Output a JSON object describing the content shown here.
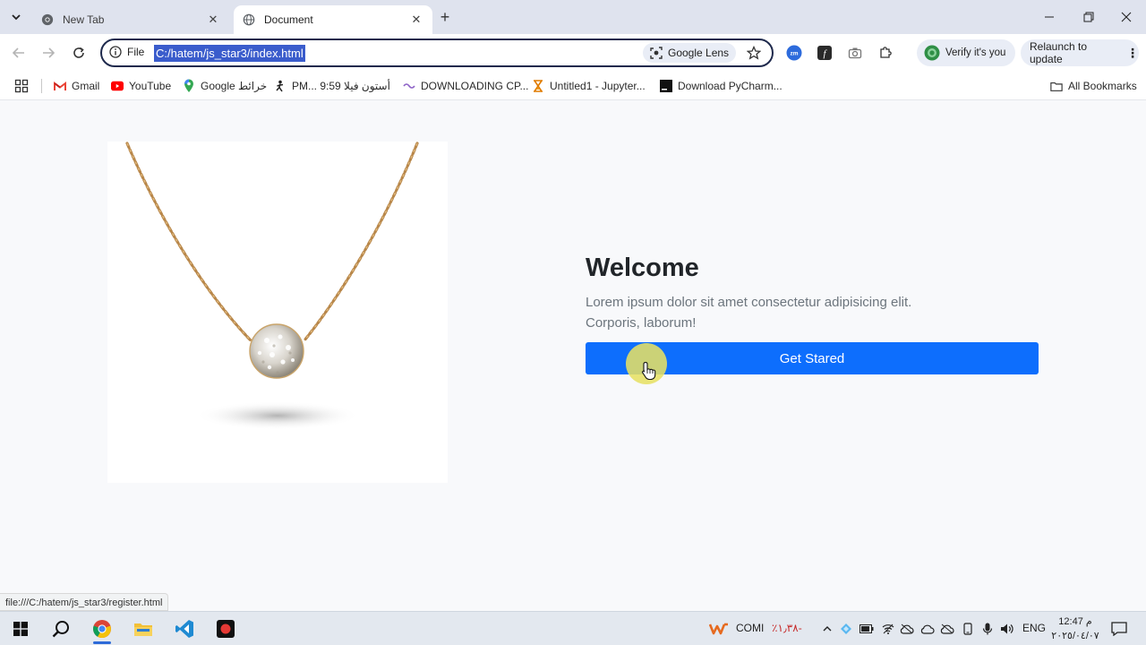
{
  "browser": {
    "tabs": [
      {
        "title": "New Tab",
        "active": false
      },
      {
        "title": "Document",
        "active": true
      }
    ],
    "address_bar": {
      "scheme_label": "File",
      "url": "C:/hatem/js_star3/index.html",
      "lens_label": "Google Lens"
    },
    "toolbar": {
      "verify_label": "Verify it's you",
      "relaunch_label": "Relaunch to update",
      "zoom_ext_label": "zm"
    },
    "bookmarks": [
      {
        "label": "Gmail",
        "icon": "gmail-icon"
      },
      {
        "label": "YouTube",
        "icon": "youtube-icon"
      },
      {
        "label": "Google خرائط",
        "icon": "maps-icon"
      },
      {
        "label": "PM... 9:59 أستون فيلا",
        "icon": "sports-icon"
      },
      {
        "label": "DOWNLOADING CP...",
        "icon": "site-icon"
      },
      {
        "label": "Untitled1 - Jupyter...",
        "icon": "jupyter-icon"
      },
      {
        "label": "Download PyCharm...",
        "icon": "pycharm-icon"
      }
    ],
    "all_bookmarks_label": "All Bookmarks",
    "status_url": "file:///C:/hatem/js_star3/register.html"
  },
  "page": {
    "title": "Welcome",
    "description": "Lorem ipsum dolor sit amet consectetur adipisicing elit. Corporis, laborum!",
    "button_label": "Get Stared",
    "image_alt": "gold necklace pendant"
  },
  "taskbar": {
    "apps": [
      "start-icon",
      "search-icon",
      "chrome-icon",
      "file-explorer-icon",
      "vscode-icon",
      "recorder-icon"
    ],
    "stock_ticker": "COMI",
    "stock_change": "٪۱٫۳۸-",
    "language": "ENG",
    "time": "12:47 م",
    "date": "۲۰۲٥/۰٤/۰۷"
  },
  "colors": {
    "primary_button": "#0d6efd",
    "heading": "#212529",
    "muted_text": "#6c757d",
    "address_highlight": "#3a5ccc",
    "cursor_highlight": "#e6e064"
  }
}
